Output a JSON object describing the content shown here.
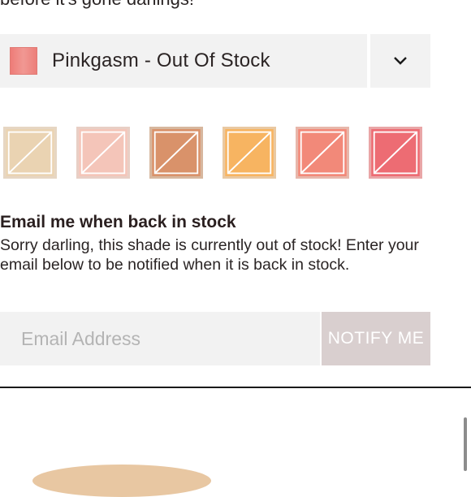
{
  "promo": {
    "text": "before it's gone darlings!"
  },
  "shade_selector": {
    "selected_label": "Pinkgasm - Out Of Stock",
    "selected_color": "#ef8a85",
    "chevron_icon": "chevron-down-icon"
  },
  "swatches": [
    {
      "name": "swatch-1",
      "color": "#ead3b2",
      "border": "#e6d6c3"
    },
    {
      "name": "swatch-2",
      "color": "#f4c5b9",
      "border": "#e8cfc5"
    },
    {
      "name": "swatch-3",
      "color": "#d9926a",
      "border": "#d7b79e"
    },
    {
      "name": "swatch-4",
      "color": "#f7b461",
      "border": "#e9c9a2"
    },
    {
      "name": "swatch-5",
      "color": "#f28979",
      "border": "#e7b7ab"
    },
    {
      "name": "swatch-6",
      "color": "#ed6c73",
      "border": "#e9a6a7"
    }
  ],
  "notify": {
    "title": "Email me when back in stock",
    "body": "Sorry darling, this shade is currently out of stock! Enter your email below to be notified when it is back in stock.",
    "email_placeholder": "Email Address",
    "button_label": "NOTIFY ME"
  }
}
